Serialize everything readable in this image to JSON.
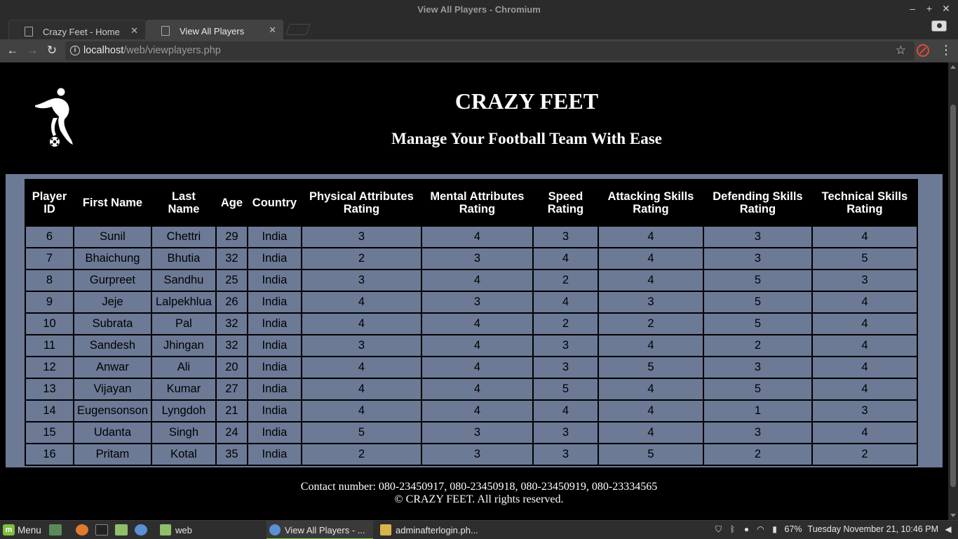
{
  "window": {
    "title": "View All Players - Chromium"
  },
  "tabs": [
    {
      "label": "Crazy Feet - Home",
      "active": false
    },
    {
      "label": "View All Players",
      "active": true
    }
  ],
  "address_bar": {
    "host": "localhost",
    "path": "/web/viewplayers.php"
  },
  "site": {
    "title": "CRAZY FEET",
    "subtitle": "Manage Your Football Team With Ease"
  },
  "table": {
    "headers": [
      "Player ID",
      "First Name",
      "Last Name",
      "Age",
      "Country",
      "Physical Attributes Rating",
      "Mental Attributes Rating",
      "Speed Rating",
      "Attacking Skills Rating",
      "Defending Skills Rating",
      "Technical Skills Rating"
    ],
    "rows": [
      [
        "6",
        "Sunil",
        "Chettri",
        "29",
        "India",
        "3",
        "4",
        "3",
        "4",
        "3",
        "4"
      ],
      [
        "7",
        "Bhaichung",
        "Bhutia",
        "32",
        "India",
        "2",
        "3",
        "4",
        "4",
        "3",
        "5"
      ],
      [
        "8",
        "Gurpreet",
        "Sandhu",
        "25",
        "India",
        "3",
        "4",
        "2",
        "4",
        "5",
        "3"
      ],
      [
        "9",
        "Jeje",
        "Lalpekhlua",
        "26",
        "India",
        "4",
        "3",
        "4",
        "3",
        "5",
        "4"
      ],
      [
        "10",
        "Subrata",
        "Pal",
        "32",
        "India",
        "4",
        "4",
        "2",
        "2",
        "5",
        "4"
      ],
      [
        "11",
        "Sandesh",
        "Jhingan",
        "32",
        "India",
        "3",
        "4",
        "3",
        "4",
        "2",
        "4"
      ],
      [
        "12",
        "Anwar",
        "Ali",
        "20",
        "India",
        "4",
        "4",
        "3",
        "5",
        "3",
        "4"
      ],
      [
        "13",
        "Vijayan",
        "Kumar",
        "27",
        "India",
        "4",
        "4",
        "5",
        "4",
        "5",
        "4"
      ],
      [
        "14",
        "Eugensonson",
        "Lyngdoh",
        "21",
        "India",
        "4",
        "4",
        "4",
        "4",
        "1",
        "3"
      ],
      [
        "15",
        "Udanta",
        "Singh",
        "24",
        "India",
        "5",
        "3",
        "3",
        "4",
        "3",
        "4"
      ],
      [
        "16",
        "Pritam",
        "Kotal",
        "35",
        "India",
        "2",
        "3",
        "3",
        "5",
        "2",
        "2"
      ]
    ]
  },
  "footer": {
    "contact": "Contact number: 080-23450917, 080-23450918, 080-23450919, 080-23334565",
    "copyright": "© CRAZY FEET. All rights reserved."
  },
  "taskbar": {
    "menu_label": "Menu",
    "folder_label": "web",
    "tasks": [
      {
        "label": "View All Players - ...",
        "active": true
      },
      {
        "label": "adminafterlogin.ph...",
        "active": false
      }
    ],
    "battery": "67%",
    "clock": "Tuesday November 21, 10:46 PM"
  },
  "colors": {
    "page_bg": "#000000",
    "table_cell_bg": "#6c7a96",
    "browser_chrome": "#424242",
    "accent_green": "#7fbf3e"
  }
}
